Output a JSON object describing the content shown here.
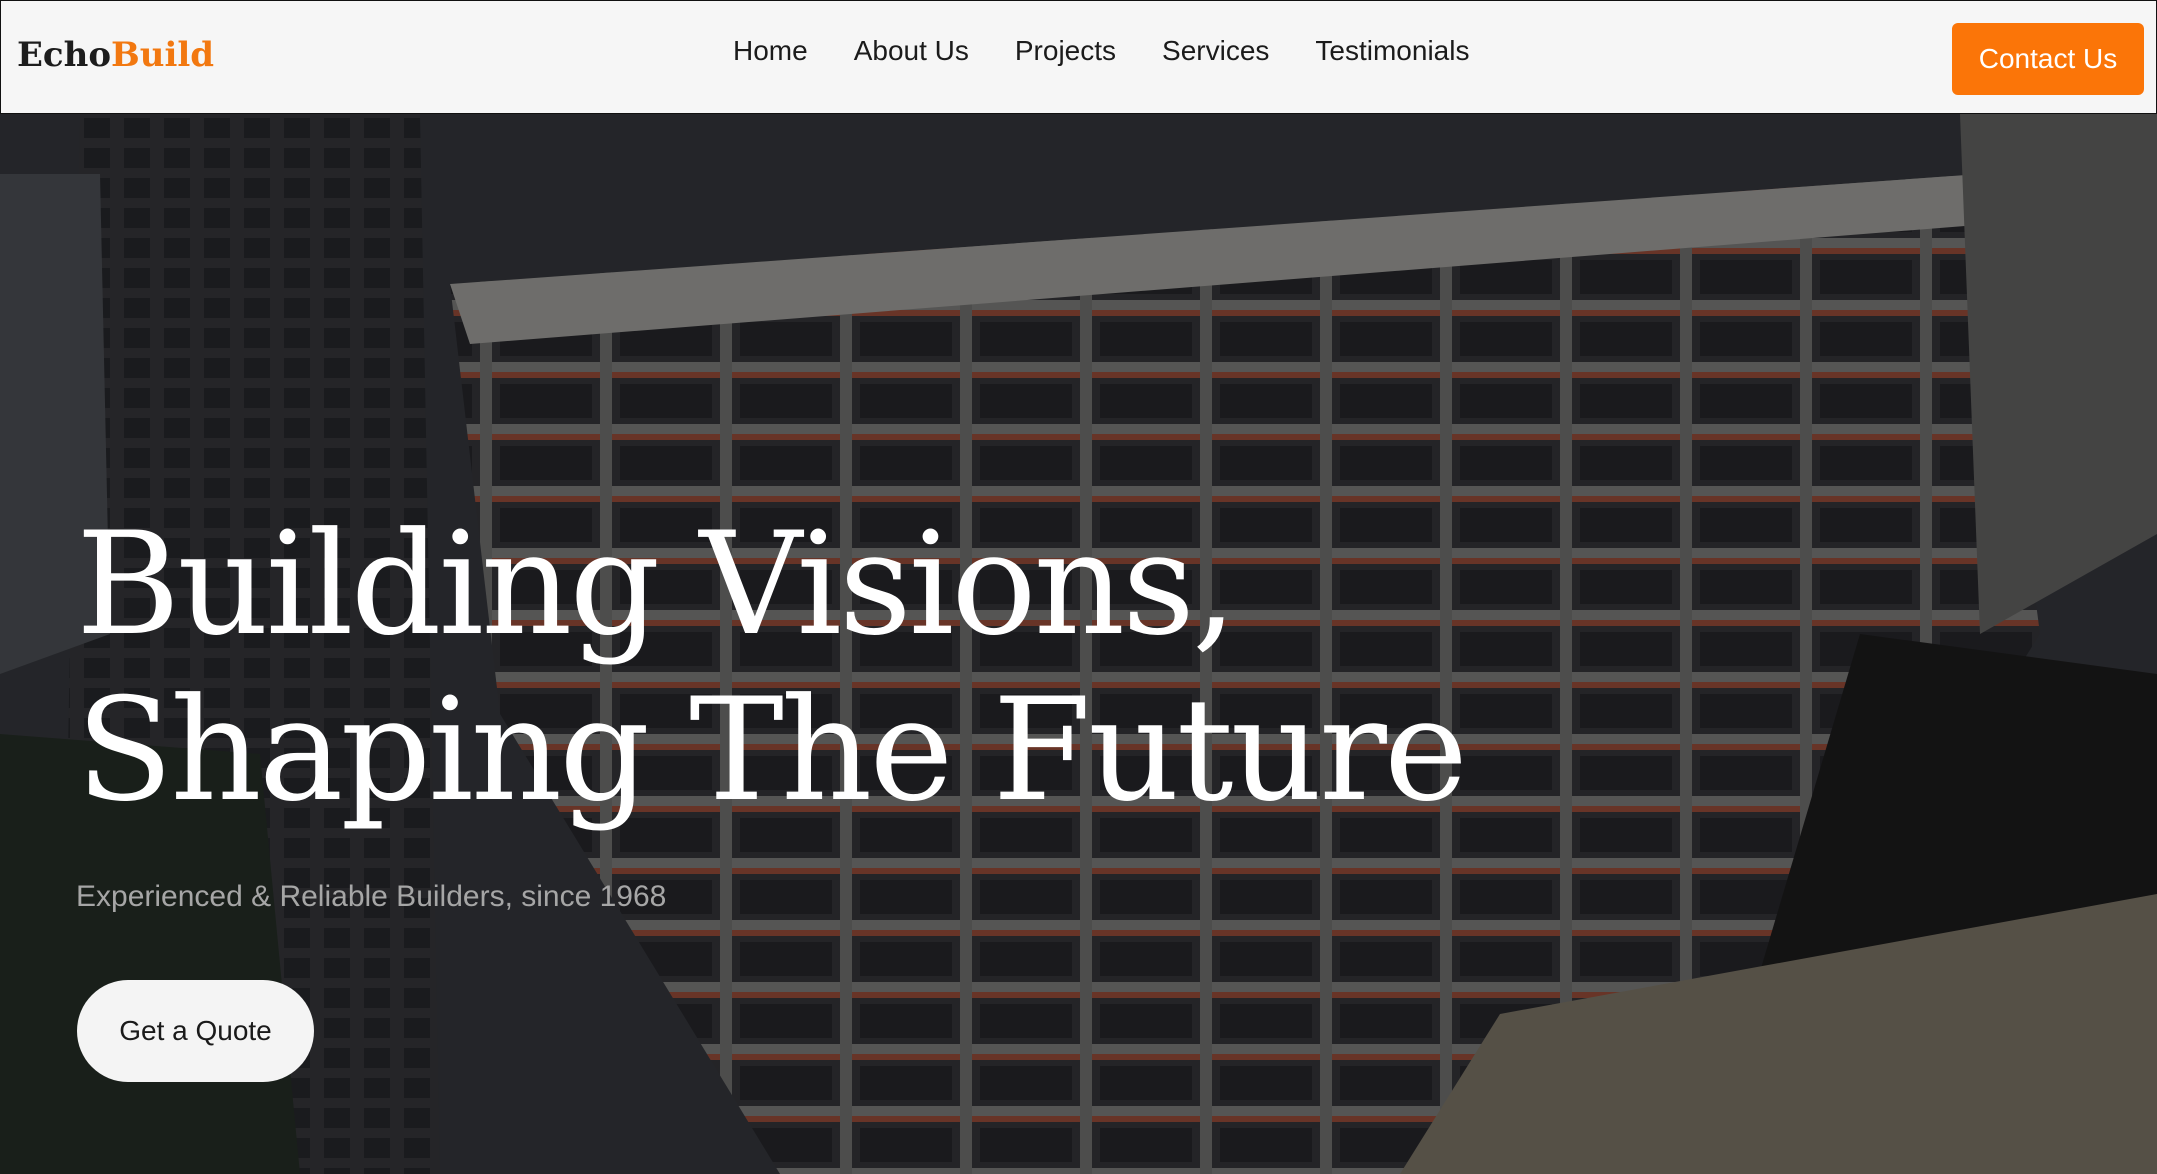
{
  "brand": {
    "name_part1": "Echo",
    "name_part2": "Build",
    "accent_color": "#f27810"
  },
  "nav": {
    "items": [
      {
        "label": "Home"
      },
      {
        "label": "About Us"
      },
      {
        "label": "Projects"
      },
      {
        "label": "Services"
      },
      {
        "label": "Testimonials"
      }
    ],
    "cta_label": "Contact Us",
    "cta_color": "#fb7508"
  },
  "hero": {
    "headline_line1": "Building Visions,",
    "headline_line2": "Shaping The Future",
    "subtitle": "Experienced & Reliable Builders, since 1968",
    "button_label": "Get a Quote",
    "background": "aerial view of high-rise building under construction"
  }
}
